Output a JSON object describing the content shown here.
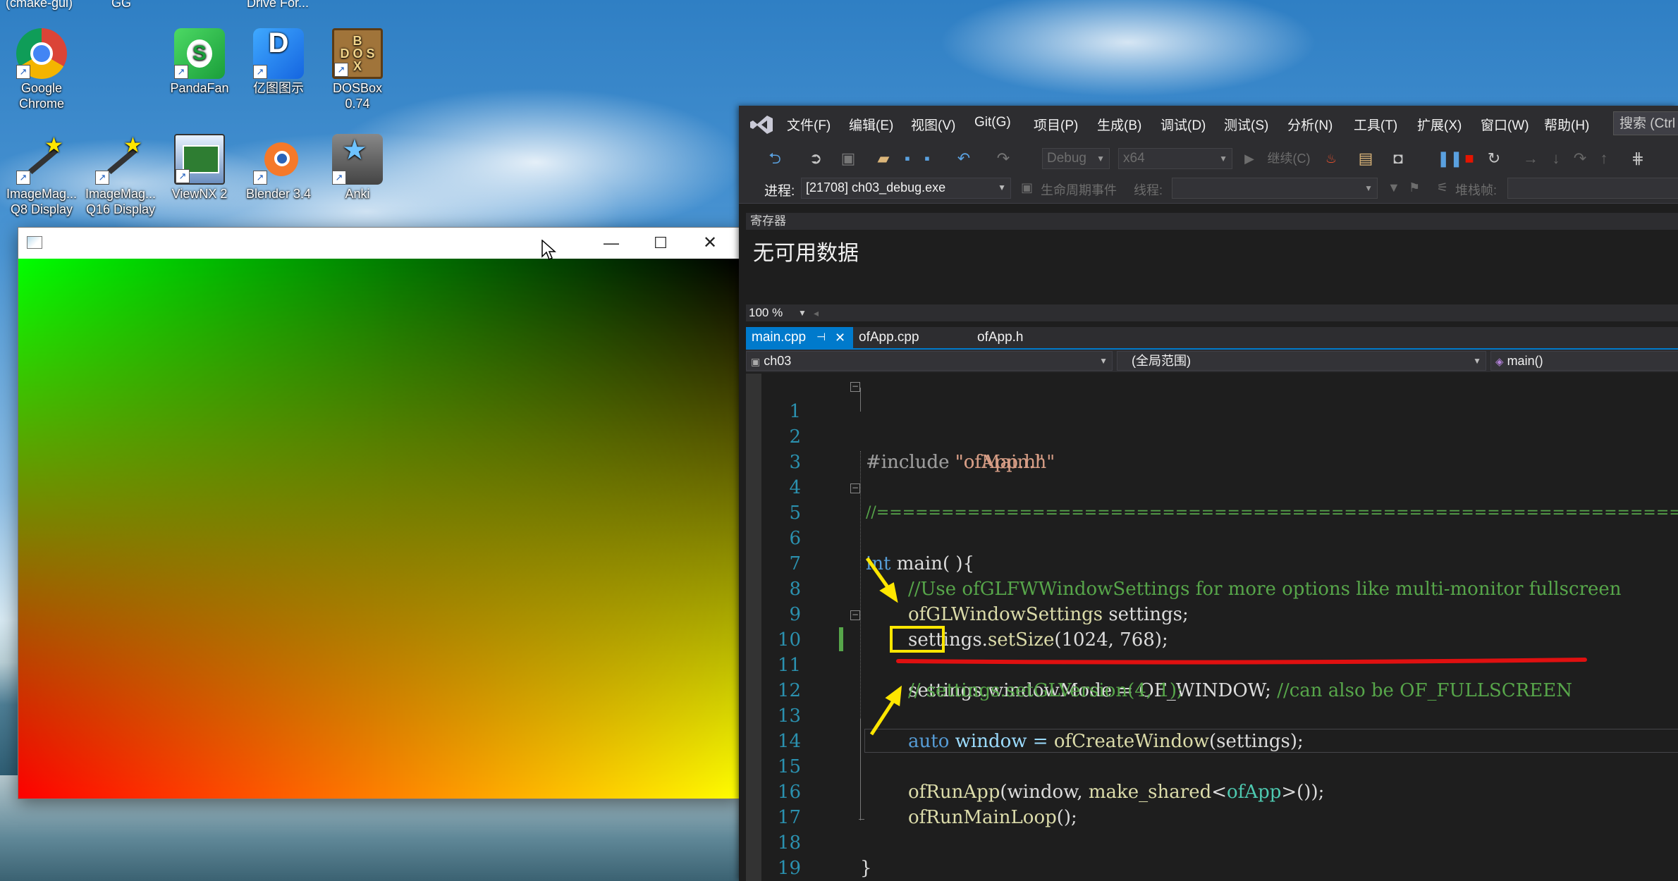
{
  "desktop": {
    "top_labels": [
      "(cmake-gui)",
      "GG",
      "Drive For..."
    ],
    "icons": [
      {
        "label": "Google Chrome",
        "icon": "chrome-icon"
      },
      {
        "label": "PandaFan",
        "icon": "pandafan-icon"
      },
      {
        "label": "亿图图示",
        "icon": "edraw-icon"
      },
      {
        "label": "DOSBox 0.74",
        "icon": "dosbox-icon"
      },
      {
        "label": "ImageMag... Q8 Display",
        "icon": "imagemagick-icon"
      },
      {
        "label": "ImageMag... Q16 Display",
        "icon": "imagemagick-icon"
      },
      {
        "label": "ViewNX 2",
        "icon": "viewnx-icon"
      },
      {
        "label": "Blender 3.4",
        "icon": "blender-icon"
      },
      {
        "label": "Anki",
        "icon": "anki-icon"
      }
    ]
  },
  "app_window": {
    "title": "",
    "controls": {
      "minimize": "—",
      "maximize": "☐",
      "close": "✕"
    },
    "gradient_colors": {
      "top_left": "#00ff00",
      "top_right": "#000000",
      "bottom_left": "#ff0000",
      "bottom_right": "#ffff00"
    }
  },
  "vs": {
    "menu": [
      "文件(F)",
      "编辑(E)",
      "视图(V)",
      "Git(G)",
      "项目(P)",
      "生成(B)",
      "调试(D)",
      "测试(S)",
      "分析(N)",
      "工具(T)",
      "扩展(X)",
      "窗口(W)",
      "帮助(H)"
    ],
    "search_placeholder": "搜索 (Ctrl",
    "toolbar": {
      "config": "Debug",
      "platform": "x64",
      "continue": "继续(C)"
    },
    "debug_bar": {
      "process_label": "进程:",
      "process_value": "[21708] ch03_debug.exe",
      "lifecycle": "生命周期事件",
      "thread_label": "线程:",
      "stack_label": "堆栈帧:"
    },
    "registers": {
      "title": "寄存器",
      "body": "无可用数据"
    },
    "zoom": "100 %",
    "tabs": [
      {
        "label": "main.cpp",
        "pin": "⊣",
        "close": "✕"
      },
      {
        "label": "ofApp.cpp"
      },
      {
        "label": "ofApp.h"
      }
    ],
    "nav": {
      "project": "ch03",
      "scope": "(全局范围)",
      "member": "main()"
    },
    "line_numbers": [
      "1",
      "2",
      "3",
      "4",
      "5",
      "6",
      "7",
      "8",
      "9",
      "10",
      "11",
      "12",
      "13",
      "14",
      "15",
      "16",
      "17",
      "18",
      "19"
    ],
    "code": {
      "l1_kw": "#include ",
      "l1_str": "\"ofMain.h\"",
      "l2_kw": "#include ",
      "l2_str": "\"ofApp.h\"",
      "l4": "//========================================================================",
      "l5_kw": "int",
      "l5_rest": " main( ){",
      "l7": "//Use ofGLFWWindowSettings for more options like multi-monitor fullscreen",
      "l8_typ": "ofGLWindowSettings",
      "l8_rest": " settings;",
      "l9_a": "settings.",
      "l9_fn": "setSize",
      "l9_b": "(1024, 768);",
      "l10_a": "settings.windowMode = OF_WINDOW; ",
      "l10_cmt": "//can also be OF_FULLSCREEN",
      "l11": "// settings.setGLVersion(4, 1);",
      "l13_kw": "auto",
      "l13_a": " window = ",
      "l13_fn": "ofCreateWindow",
      "l13_b": "(settings);",
      "l15_fn": "ofRunApp",
      "l15_a": "(window, ",
      "l15_fn2": "make_shared",
      "l15_b": "<",
      "l15_typ": "ofApp",
      "l15_c": ">());",
      "l16_fn": "ofRunMainLoop",
      "l16_a": "();",
      "l18": "}"
    },
    "colors": {
      "accent": "#007acc",
      "bg": "#1e1e1e",
      "annotation_yellow": "#ffe600",
      "annotation_red": "#e01010"
    }
  }
}
